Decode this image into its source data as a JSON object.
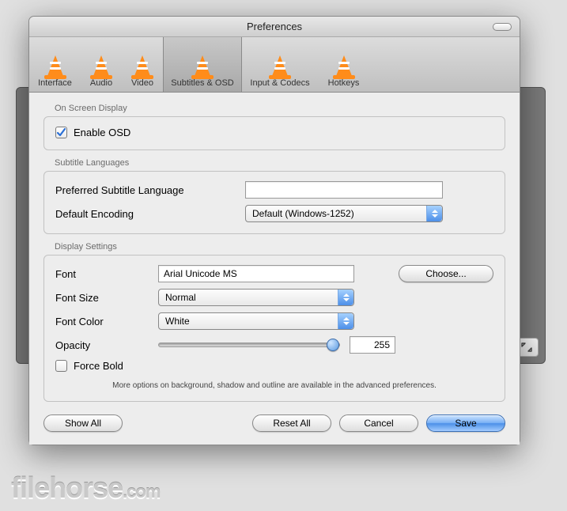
{
  "window": {
    "title": "Preferences"
  },
  "tabs": {
    "interface": "Interface",
    "audio": "Audio",
    "video": "Video",
    "subtitles": "Subtitles & OSD",
    "input": "Input & Codecs",
    "hotkeys": "Hotkeys"
  },
  "osd": {
    "group_label": "On Screen Display",
    "enable_label": "Enable OSD",
    "enable_checked": true
  },
  "lang": {
    "group_label": "Subtitle Languages",
    "preferred_label": "Preferred Subtitle Language",
    "preferred_value": "",
    "encoding_label": "Default Encoding",
    "encoding_value": "Default (Windows-1252)"
  },
  "display": {
    "group_label": "Display Settings",
    "font_label": "Font",
    "font_value": "Arial Unicode MS",
    "choose_label": "Choose...",
    "size_label": "Font Size",
    "size_value": "Normal",
    "color_label": "Font Color",
    "color_value": "White",
    "opacity_label": "Opacity",
    "opacity_value": "255",
    "force_bold_label": "Force Bold",
    "force_bold_checked": false,
    "note": "More options on background, shadow and outline are available in the advanced preferences."
  },
  "buttons": {
    "show_all": "Show All",
    "reset_all": "Reset All",
    "cancel": "Cancel",
    "save": "Save"
  },
  "watermark": {
    "a": "filehorse",
    "b": ".com"
  }
}
